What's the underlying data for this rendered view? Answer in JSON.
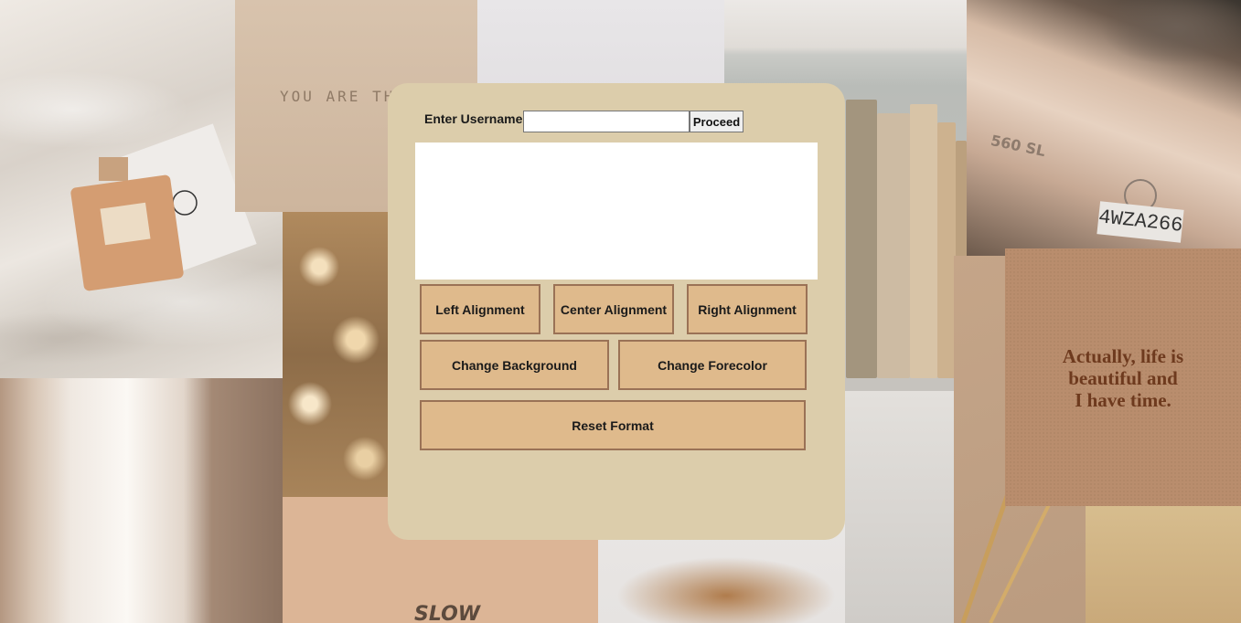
{
  "collage": {
    "card_text": "YOU ARE TH",
    "quote_text": "Actually, life is\nbeautiful and\nI have time.",
    "slow_text": "SLOW",
    "car_badge": "560 SL",
    "plate_text": "4WZA266"
  },
  "form": {
    "username_label": "Enter Username",
    "username_value": "",
    "proceed_label": "Proceed",
    "textarea_value": ""
  },
  "buttons": {
    "left_alignment": "Left Alignment",
    "center_alignment": "Center Alignment",
    "right_alignment": "Right Alignment",
    "change_background": "Change Background",
    "change_forecolor": "Change Forecolor",
    "reset_format": "Reset Format"
  },
  "colors": {
    "panel": "#dccdab",
    "button": "#dfba8c",
    "button_border": "#9a7256"
  }
}
